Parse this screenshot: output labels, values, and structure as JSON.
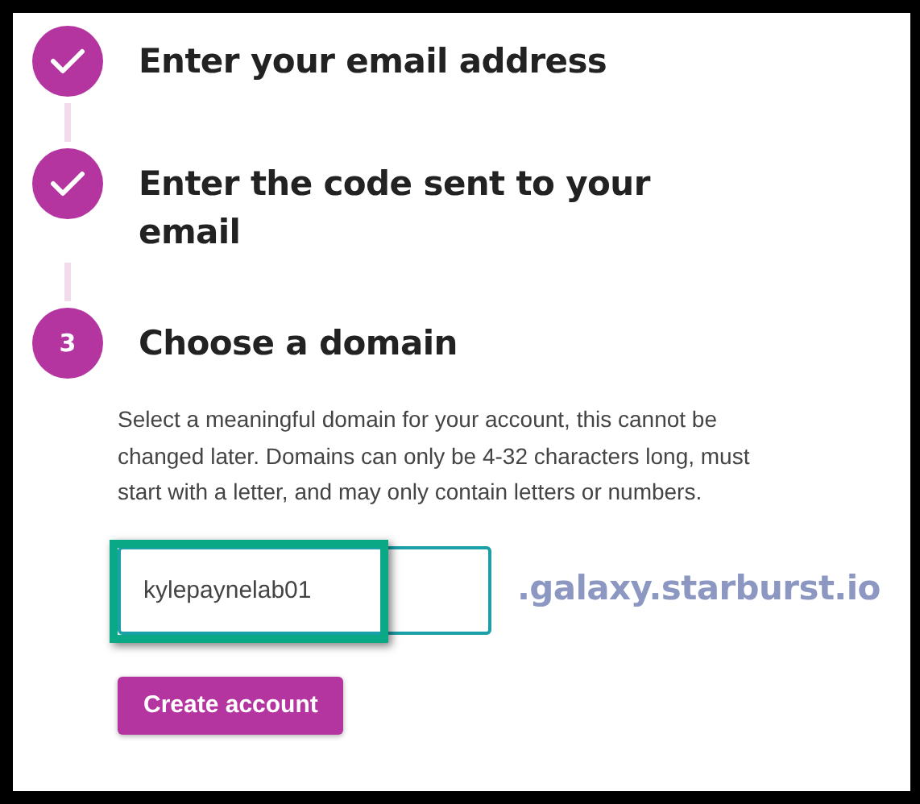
{
  "steps": [
    {
      "title": "Enter your email address",
      "completed": true
    },
    {
      "title": "Enter the code sent to your email",
      "completed": true
    },
    {
      "title": "Choose a domain",
      "completed": false,
      "number": "3"
    }
  ],
  "description": "Select a meaningful domain for your account, this cannot be changed later. Domains can only be 4-32 characters long, must start with a letter, and may only contain letters or numbers.",
  "domain_field": {
    "value": "kylepaynelab01",
    "highlighted": true
  },
  "domain_suffix": ".galaxy.starburst.io",
  "button": "Create account"
}
